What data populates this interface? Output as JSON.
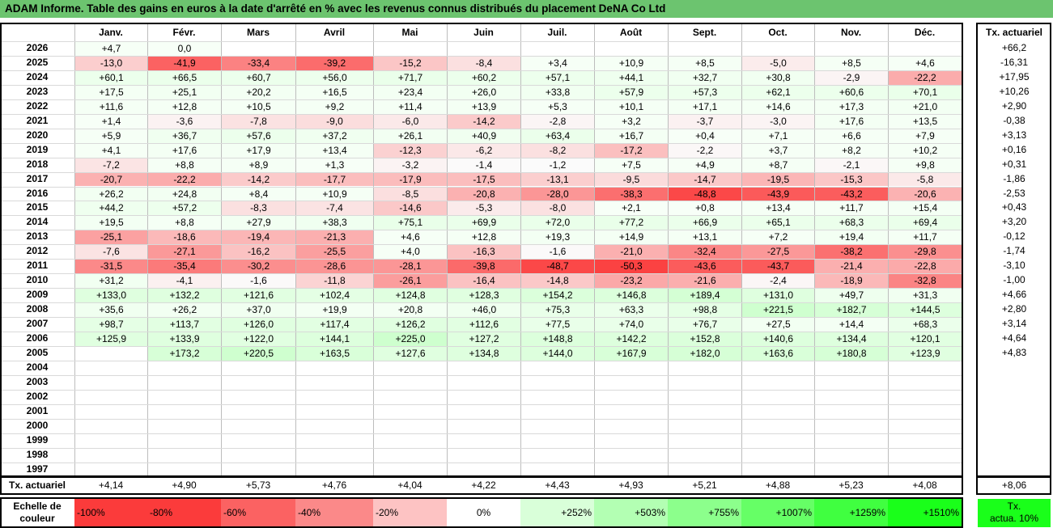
{
  "title": "ADAM Informe. Table des gains en euros à la date d'arrêté en % avec les revenus connus distribués du placement DeNA Co Ltd",
  "months": [
    "Janv.",
    "Févr.",
    "Mars",
    "Avril",
    "Mai",
    "Juin",
    "Juil.",
    "Août",
    "Sept.",
    "Oct.",
    "Nov.",
    "Déc."
  ],
  "tx_header": "Tx. actuariel",
  "rows": [
    {
      "year": "2026",
      "values": [
        "+4,7",
        "0,0",
        "",
        "",
        "",
        "",
        "",
        "",
        "",
        "",
        "",
        ""
      ],
      "tx": "+66,2"
    },
    {
      "year": "2025",
      "values": [
        "-13,0",
        "-41,9",
        "-33,4",
        "-39,2",
        "-15,2",
        "-8,4",
        "+3,4",
        "+10,9",
        "+8,5",
        "-5,0",
        "+8,5",
        "+4,6"
      ],
      "tx": "-16,31"
    },
    {
      "year": "2024",
      "values": [
        "+60,1",
        "+66,5",
        "+60,7",
        "+56,0",
        "+71,7",
        "+60,2",
        "+57,1",
        "+44,1",
        "+32,7",
        "+30,8",
        "-2,9",
        "-22,2"
      ],
      "tx": "+17,95"
    },
    {
      "year": "2023",
      "values": [
        "+17,5",
        "+25,1",
        "+20,2",
        "+16,5",
        "+23,4",
        "+26,0",
        "+33,8",
        "+57,9",
        "+57,3",
        "+62,1",
        "+60,6",
        "+70,1"
      ],
      "tx": "+10,26"
    },
    {
      "year": "2022",
      "values": [
        "+11,6",
        "+12,8",
        "+10,5",
        "+9,2",
        "+11,4",
        "+13,9",
        "+5,3",
        "+10,1",
        "+17,1",
        "+14,6",
        "+17,3",
        "+21,0"
      ],
      "tx": "+2,90"
    },
    {
      "year": "2021",
      "values": [
        "+1,4",
        "-3,6",
        "-7,8",
        "-9,0",
        "-6,0",
        "-14,2",
        "-2,8",
        "+3,2",
        "-3,7",
        "-3,0",
        "+17,6",
        "+13,5"
      ],
      "tx": "-0,38"
    },
    {
      "year": "2020",
      "values": [
        "+5,9",
        "+36,7",
        "+57,6",
        "+37,2",
        "+26,1",
        "+40,9",
        "+63,4",
        "+16,7",
        "+0,4",
        "+7,1",
        "+6,6",
        "+7,9"
      ],
      "tx": "+3,13"
    },
    {
      "year": "2019",
      "values": [
        "+4,1",
        "+17,6",
        "+17,9",
        "+13,4",
        "-12,3",
        "-6,2",
        "-8,2",
        "-17,2",
        "-2,2",
        "+3,7",
        "+8,2",
        "+10,2"
      ],
      "tx": "+0,16"
    },
    {
      "year": "2018",
      "values": [
        "-7,2",
        "+8,8",
        "+8,9",
        "+1,3",
        "-3,2",
        "-1,4",
        "-1,2",
        "+7,5",
        "+4,9",
        "+8,7",
        "-2,1",
        "+9,8"
      ],
      "tx": "+0,31"
    },
    {
      "year": "2017",
      "values": [
        "-20,7",
        "-22,2",
        "-14,2",
        "-17,7",
        "-17,9",
        "-17,5",
        "-13,1",
        "-9,5",
        "-14,7",
        "-19,5",
        "-15,3",
        "-5,8"
      ],
      "tx": "-1,86"
    },
    {
      "year": "2016",
      "values": [
        "+26,2",
        "+24,8",
        "+8,4",
        "+10,9",
        "-8,5",
        "-20,8",
        "-28,0",
        "-38,3",
        "-48,8",
        "-43,9",
        "-43,2",
        "-20,6"
      ],
      "tx": "-2,53"
    },
    {
      "year": "2015",
      "values": [
        "+44,2",
        "+57,2",
        "-8,3",
        "-7,4",
        "-14,6",
        "-5,3",
        "-8,0",
        "+2,1",
        "+0,8",
        "+13,4",
        "+11,7",
        "+15,4"
      ],
      "tx": "+0,43"
    },
    {
      "year": "2014",
      "values": [
        "+19,5",
        "+8,8",
        "+27,9",
        "+38,3",
        "+75,1",
        "+69,9",
        "+72,0",
        "+77,2",
        "+66,9",
        "+65,1",
        "+68,3",
        "+69,4"
      ],
      "tx": "+3,20"
    },
    {
      "year": "2013",
      "values": [
        "-25,1",
        "-18,6",
        "-19,4",
        "-21,3",
        "+4,6",
        "+12,8",
        "+19,3",
        "+14,9",
        "+13,1",
        "+7,2",
        "+19,4",
        "+11,7"
      ],
      "tx": "-0,12"
    },
    {
      "year": "2012",
      "values": [
        "-7,6",
        "-27,1",
        "-16,2",
        "-25,5",
        "+4,0",
        "-16,3",
        "-1,6",
        "-21,0",
        "-32,4",
        "-27,5",
        "-38,2",
        "-29,8"
      ],
      "tx": "-1,74"
    },
    {
      "year": "2011",
      "values": [
        "-31,5",
        "-35,4",
        "-30,2",
        "-28,6",
        "-28,1",
        "-39,8",
        "-48,7",
        "-50,3",
        "-43,6",
        "-43,7",
        "-21,4",
        "-22,8"
      ],
      "tx": "-3,10"
    },
    {
      "year": "2010",
      "values": [
        "+31,2",
        "-4,1",
        "-1,6",
        "-11,8",
        "-26,1",
        "-16,4",
        "-14,8",
        "-23,2",
        "-21,6",
        "-2,4",
        "-18,9",
        "-32,8"
      ],
      "tx": "-1,00"
    },
    {
      "year": "2009",
      "values": [
        "+133,0",
        "+132,2",
        "+121,6",
        "+102,4",
        "+124,8",
        "+128,3",
        "+154,2",
        "+146,8",
        "+189,4",
        "+131,0",
        "+49,7",
        "+31,3"
      ],
      "tx": "+4,66"
    },
    {
      "year": "2008",
      "values": [
        "+35,6",
        "+26,2",
        "+37,0",
        "+19,9",
        "+20,8",
        "+46,0",
        "+75,3",
        "+63,3",
        "+98,8",
        "+221,5",
        "+182,7",
        "+144,5"
      ],
      "tx": "+2,80"
    },
    {
      "year": "2007",
      "values": [
        "+98,7",
        "+113,7",
        "+126,0",
        "+117,4",
        "+126,2",
        "+112,6",
        "+77,5",
        "+74,0",
        "+76,7",
        "+27,5",
        "+14,4",
        "+68,3"
      ],
      "tx": "+3,14"
    },
    {
      "year": "2006",
      "values": [
        "+125,9",
        "+133,9",
        "+122,0",
        "+144,1",
        "+225,0",
        "+127,2",
        "+148,8",
        "+142,2",
        "+152,8",
        "+140,6",
        "+134,4",
        "+120,1"
      ],
      "tx": "+4,64"
    },
    {
      "year": "2005",
      "values": [
        "",
        "+173,2",
        "+220,5",
        "+163,5",
        "+127,6",
        "+134,8",
        "+144,0",
        "+167,9",
        "+182,0",
        "+163,6",
        "+180,8",
        "+123,9"
      ],
      "tx": "+4,83"
    },
    {
      "year": "2004",
      "values": [
        "",
        "",
        "",
        "",
        "",
        "",
        "",
        "",
        "",
        "",
        "",
        ""
      ],
      "tx": ""
    },
    {
      "year": "2003",
      "values": [
        "",
        "",
        "",
        "",
        "",
        "",
        "",
        "",
        "",
        "",
        "",
        ""
      ],
      "tx": ""
    },
    {
      "year": "2002",
      "values": [
        "",
        "",
        "",
        "",
        "",
        "",
        "",
        "",
        "",
        "",
        "",
        ""
      ],
      "tx": ""
    },
    {
      "year": "2001",
      "values": [
        "",
        "",
        "",
        "",
        "",
        "",
        "",
        "",
        "",
        "",
        "",
        ""
      ],
      "tx": ""
    },
    {
      "year": "2000",
      "values": [
        "",
        "",
        "",
        "",
        "",
        "",
        "",
        "",
        "",
        "",
        "",
        ""
      ],
      "tx": ""
    },
    {
      "year": "1999",
      "values": [
        "",
        "",
        "",
        "",
        "",
        "",
        "",
        "",
        "",
        "",
        "",
        ""
      ],
      "tx": ""
    },
    {
      "year": "1998",
      "values": [
        "",
        "",
        "",
        "",
        "",
        "",
        "",
        "",
        "",
        "",
        "",
        ""
      ],
      "tx": ""
    },
    {
      "year": "1997",
      "values": [
        "",
        "",
        "",
        "",
        "",
        "",
        "",
        "",
        "",
        "",
        "",
        ""
      ],
      "tx": ""
    }
  ],
  "footer": {
    "label": "Tx. actuariel",
    "values": [
      "+4,14",
      "+4,90",
      "+5,73",
      "+4,76",
      "+4,04",
      "+4,22",
      "+4,43",
      "+4,93",
      "+5,21",
      "+4,88",
      "+5,23",
      "+4,08"
    ],
    "tx": "+8,06"
  },
  "scale": {
    "label_line1": "Echelle de",
    "label_line2": "couleur",
    "items": [
      {
        "text": "-100%",
        "color": "#fb3b3b",
        "align": "left"
      },
      {
        "text": "-80%",
        "color": "#fb3b3b",
        "align": "left"
      },
      {
        "text": "-60%",
        "color": "#fb6262",
        "align": "left"
      },
      {
        "text": "-40%",
        "color": "#fb8989",
        "align": "left"
      },
      {
        "text": "-20%",
        "color": "#fdc3c3",
        "align": "left"
      },
      {
        "text": "0%",
        "color": "#ffffff",
        "align": "center"
      },
      {
        "text": "+252%",
        "color": "#d9ffd9",
        "align": "right"
      },
      {
        "text": "+503%",
        "color": "#b3ffb3",
        "align": "right"
      },
      {
        "text": "+755%",
        "color": "#8cff8c",
        "align": "right"
      },
      {
        "text": "+1007%",
        "color": "#66ff66",
        "align": "right"
      },
      {
        "text": "+1259%",
        "color": "#40ff40",
        "align": "right"
      },
      {
        "text": "+1510%",
        "color": "#1aff1a",
        "align": "right"
      }
    ],
    "tx_line1": "Tx.",
    "tx_line2": "actua. 10%",
    "tx_color": "#1aff1a"
  }
}
